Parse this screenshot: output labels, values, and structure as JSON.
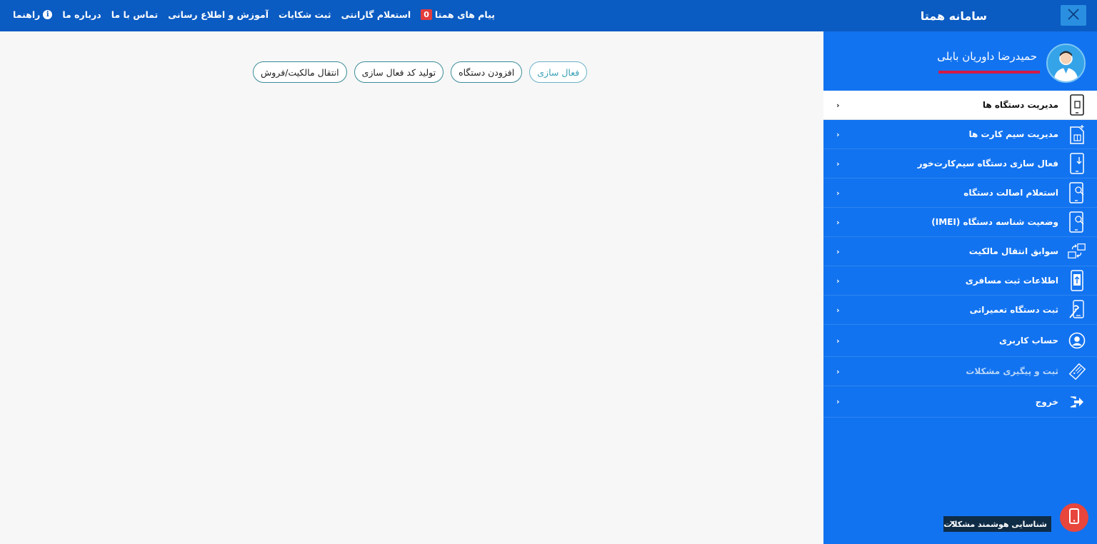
{
  "header": {
    "app_title": "سامانه همتا",
    "nav": {
      "guide": "راهنما",
      "about": "درباره ما",
      "contact": "تماس با ما",
      "education": "آموزش و اطلاع رسانی",
      "complaints": "ثبت شکایات",
      "warranty": "استعلام گارانتی",
      "messages": "پیام های همتا",
      "messages_count": "0"
    }
  },
  "sidebar": {
    "user_name": "حمیدرضا داوریان بابلی",
    "items": [
      {
        "label": "مدیریت دستگاه ها",
        "icon": "phone-device-icon",
        "active": true
      },
      {
        "label": "مدیریت سیم کارت ها",
        "icon": "sim-card-icon"
      },
      {
        "label": "فعال سازی دستگاه سیم‌کارت‌خور",
        "icon": "phone-activate-icon"
      },
      {
        "label": "استعلام اصالت دستگاه",
        "icon": "phone-search-icon"
      },
      {
        "label": "وضعیت شناسه دستگاه (IMEI)",
        "icon": "phone-imei-search-icon"
      },
      {
        "label": "سوابق انتقال مالکیت",
        "icon": "ownership-transfer-icon"
      },
      {
        "label": "اطلاعات ثبت مسافری",
        "icon": "phone-upload-icon"
      },
      {
        "label": "ثبت دستگاه تعمیراتی",
        "icon": "repair-tools-icon"
      },
      {
        "label": "حساب کاربری",
        "icon": "user-account-icon"
      },
      {
        "label": "ثبت و پیگیری مشکلات",
        "icon": "ticket-icon",
        "dim": true
      },
      {
        "label": "خروج",
        "icon": "logout-icon"
      }
    ]
  },
  "main": {
    "buttons": {
      "ownership_transfer": "انتقال مالکیت/فروش",
      "generate_code": "تولید کد فعال سازی",
      "add_device": "افزودن دستگاه",
      "activation": "فعال سازی"
    }
  },
  "widget": {
    "smart_tip": "شناسایی هوشمند مشکلات",
    "close": "×"
  },
  "colors": {
    "topbar": "#0a5bc2",
    "sidebar": "#1273f0",
    "accent_red": "#d41a45",
    "fab": "#e8453c"
  }
}
